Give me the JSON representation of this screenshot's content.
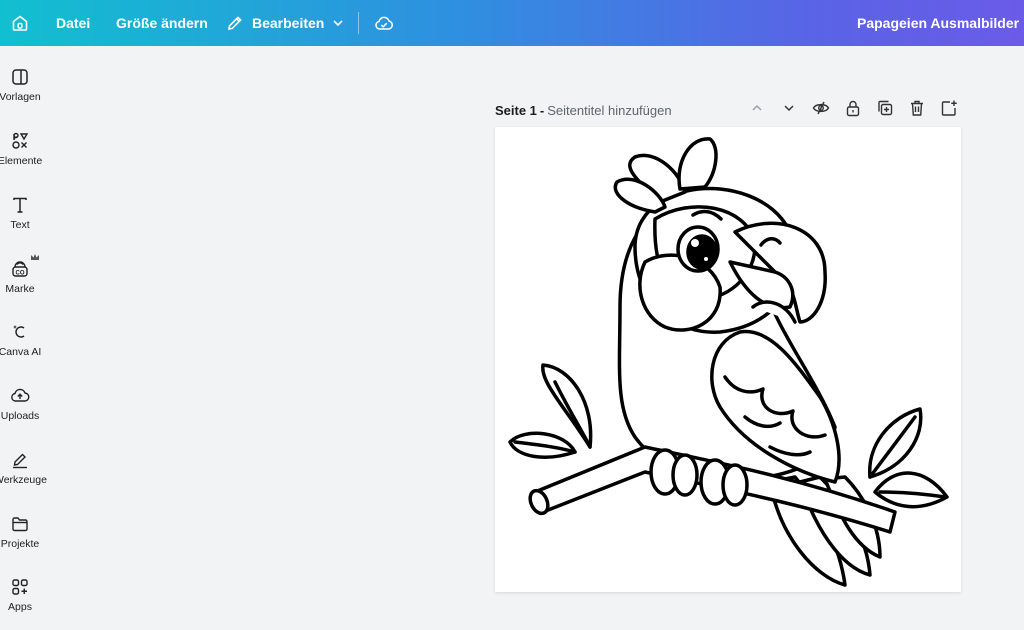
{
  "topbar": {
    "home_icon": "home-icon",
    "file_label": "Datei",
    "resize_label": "Größe ändern",
    "edit_label": "Bearbeiten",
    "edit_icon": "pencil-icon",
    "cloud_icon": "cloud-check-icon",
    "doc_title": "Papageien Ausmalbilder"
  },
  "sidebar": {
    "items": [
      {
        "label": "Vorlagen",
        "icon": "templates-icon"
      },
      {
        "label": "Elemente",
        "icon": "elements-icon"
      },
      {
        "label": "Text",
        "icon": "text-icon"
      },
      {
        "label": "Marke",
        "icon": "brand-icon"
      },
      {
        "label": "Canva AI",
        "icon": "canva-ai-icon"
      },
      {
        "label": "Uploads",
        "icon": "upload-icon"
      },
      {
        "label": "Werkzeuge",
        "icon": "tools-icon"
      },
      {
        "label": "Projekte",
        "icon": "folder-icon"
      },
      {
        "label": "Apps",
        "icon": "apps-icon"
      }
    ]
  },
  "page": {
    "title": "Seite 1",
    "separator": "-",
    "subtitle": "Seitentitel hinzufügen",
    "tools": [
      "chevron-up-icon",
      "chevron-down-icon",
      "hide-icon",
      "lock-icon",
      "duplicate-icon",
      "trash-icon",
      "add-page-icon"
    ]
  },
  "canvas": {
    "image": "parrot-coloring-page"
  }
}
